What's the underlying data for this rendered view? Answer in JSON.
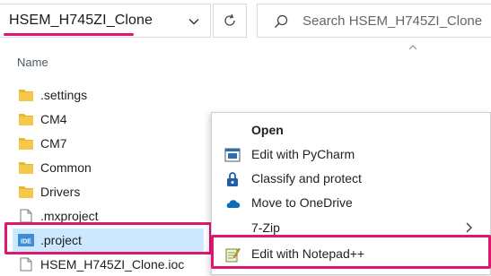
{
  "address_bar": {
    "path": "HSEM_H745ZI_Clone"
  },
  "search": {
    "placeholder": "Search HSEM_H745ZI_Clone"
  },
  "columns": {
    "name": "Name"
  },
  "files": [
    {
      "name": ".settings",
      "icon": "folder-icon"
    },
    {
      "name": "CM4",
      "icon": "folder-icon"
    },
    {
      "name": "CM7",
      "icon": "folder-icon"
    },
    {
      "name": "Common",
      "icon": "folder-icon"
    },
    {
      "name": "Drivers",
      "icon": "folder-icon"
    },
    {
      "name": ".mxproject",
      "icon": "file-icon"
    },
    {
      "name": ".project",
      "icon": "ide-file-icon",
      "selected": true
    },
    {
      "name": "HSEM_H745ZI_Clone.ioc",
      "icon": "file-icon"
    }
  ],
  "context_menu": {
    "items": [
      {
        "label": "Open",
        "bold": true
      },
      {
        "label": "Edit with PyCharm",
        "icon": "pycharm-icon"
      },
      {
        "label": "Classify and protect",
        "icon": "lock-shield-icon"
      },
      {
        "label": "Move to OneDrive",
        "icon": "onedrive-cloud-icon"
      },
      {
        "label": "7-Zip",
        "submenu": true
      },
      {
        "label": "Edit with Notepad++",
        "icon": "notepadpp-icon"
      }
    ]
  },
  "colors": {
    "highlight": "#e0176f",
    "selection": "#cce8ff",
    "folder": "#e8b732",
    "onedrive": "#0f6cbd"
  }
}
